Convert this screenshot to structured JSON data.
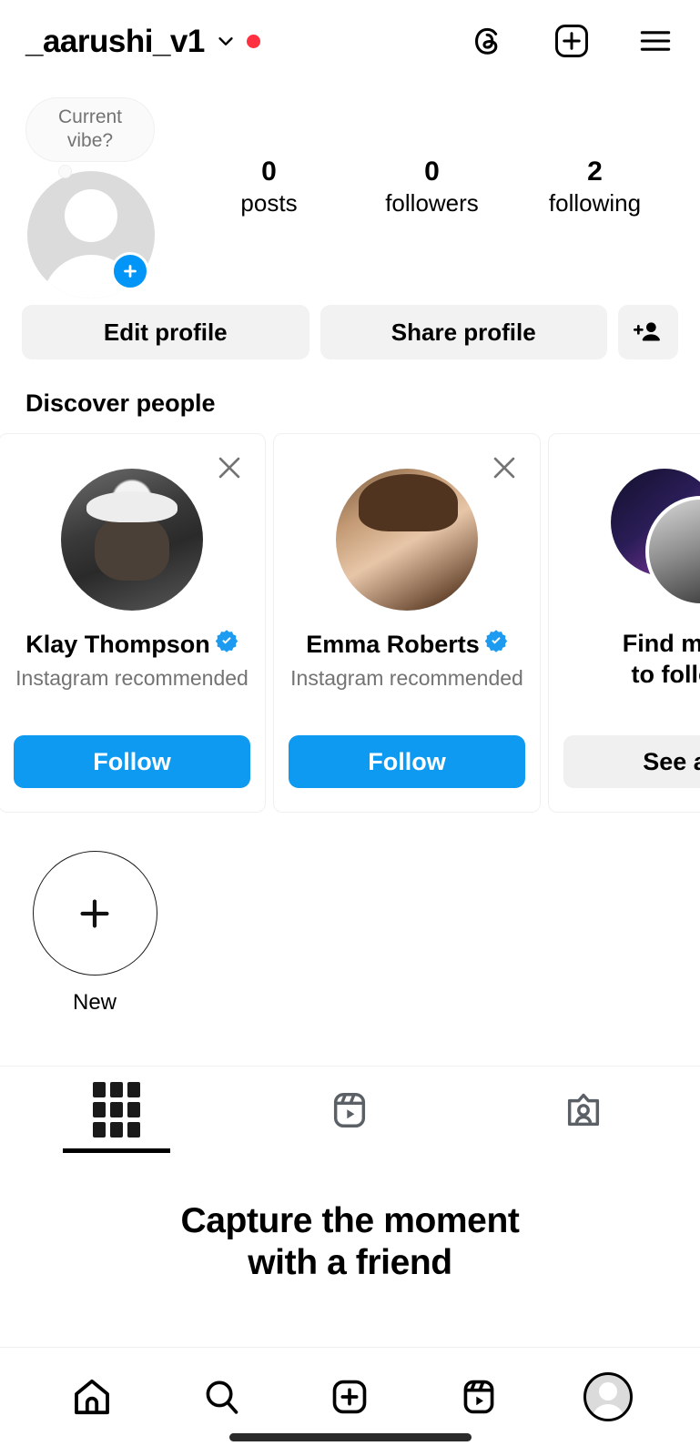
{
  "header": {
    "username": "_aarushi_v1",
    "chevron_icon": "chevron-down-icon",
    "status_dot_color": "#ff3040",
    "icons": [
      {
        "name": "threads-icon",
        "label": "Threads"
      },
      {
        "name": "new-post-icon",
        "label": "New post"
      },
      {
        "name": "menu-icon",
        "label": "Menu"
      }
    ]
  },
  "profile": {
    "note": {
      "text": "Current vibe?"
    },
    "avatar_name": "profile-avatar",
    "add_story_label": "+",
    "stats": [
      {
        "value": "0",
        "label": "posts"
      },
      {
        "value": "0",
        "label": "followers"
      },
      {
        "value": "2",
        "label": "following"
      }
    ]
  },
  "actions": {
    "edit_profile": "Edit profile",
    "share_profile": "Share profile",
    "discover_people_icon": "add-person-icon"
  },
  "discover": {
    "title": "Discover people",
    "cards": [
      {
        "name": "Klay Thompson",
        "verified": true,
        "subtitle": "Instagram recommended",
        "button": "Follow",
        "button_style": "primary",
        "avatar_name": "suggested-user-avatar-klay-thompson"
      },
      {
        "name": "Emma Roberts",
        "verified": true,
        "subtitle": "Instagram recommended",
        "button": "Follow",
        "button_style": "primary",
        "avatar_name": "suggested-user-avatar-emma-roberts"
      },
      {
        "name": "Find more\nto follow",
        "verified": false,
        "subtitle": "",
        "button": "See all",
        "button_style": "secondary",
        "avatar_name": "find-more-avatars"
      }
    ]
  },
  "highlights": [
    {
      "label": "New",
      "icon": "plus-icon"
    }
  ],
  "tabs": [
    {
      "name": "tab-grid",
      "icon": "grid-icon",
      "active": true
    },
    {
      "name": "tab-reels",
      "icon": "reels-icon",
      "active": false
    },
    {
      "name": "tab-tagged",
      "icon": "tagged-icon",
      "active": false
    }
  ],
  "empty_state": {
    "title_line1": "Capture the moment",
    "title_line2": "with a friend"
  },
  "bottom_nav": [
    {
      "name": "nav-home",
      "icon": "home-icon"
    },
    {
      "name": "nav-search",
      "icon": "search-icon"
    },
    {
      "name": "nav-create",
      "icon": "plus-box-icon"
    },
    {
      "name": "nav-reels",
      "icon": "reels-icon"
    },
    {
      "name": "nav-profile",
      "icon": "profile-avatar-icon"
    }
  ],
  "colors": {
    "accent_blue": "#0095f6",
    "follow_blue": "#0e9af0",
    "verified_blue": "#1c9bf0",
    "button_gray": "#f2f2f2",
    "text_secondary": "#737373",
    "notification_red": "#ff3040"
  }
}
